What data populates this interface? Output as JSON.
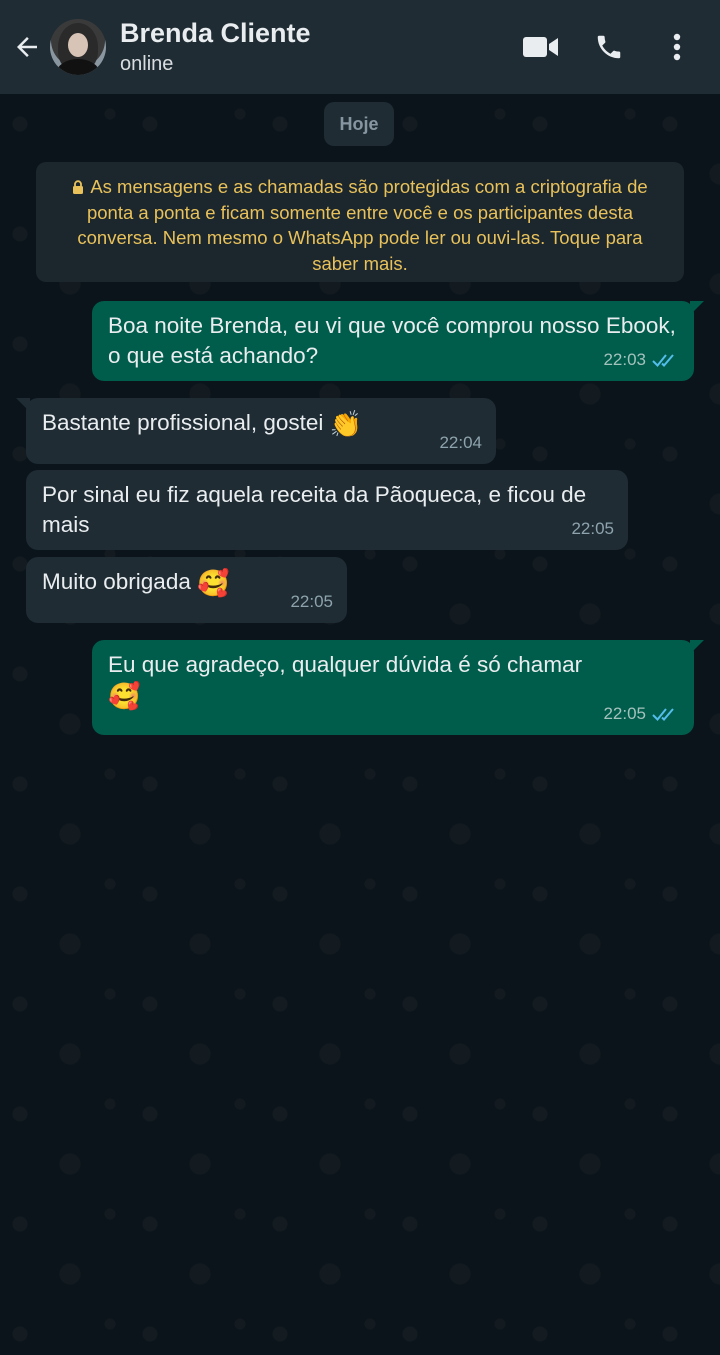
{
  "header": {
    "name": "Brenda Cliente",
    "status": "online",
    "icons": {
      "back": "back-arrow-icon",
      "video": "video-call-icon",
      "call": "phone-call-icon",
      "menu": "more-vert-icon"
    }
  },
  "chat": {
    "date_chip": "Hoje",
    "encryption_notice": "As mensagens e as chamadas são protegidas com a criptografia de ponta a ponta e ficam somente entre você e os participantes desta conversa. Nem mesmo o WhatsApp pode ler ou ouvi-las. Toque para saber mais.",
    "messages": [
      {
        "direction": "out",
        "text": "Boa noite Brenda, eu vi que você comprou nosso Ebook, o que está achando?",
        "time": "22:03",
        "status": "read"
      },
      {
        "direction": "in",
        "text": "Bastante profissional, gostei",
        "emoji": "👏",
        "time": "22:04"
      },
      {
        "direction": "in",
        "text": "Por sinal eu fiz aquela receita da Pãoqueca, e ficou de mais",
        "time": "22:05"
      },
      {
        "direction": "in",
        "text": "Muito obrigada",
        "emoji": "🥰",
        "time": "22:05"
      },
      {
        "direction": "out",
        "text": "Eu que agradeço, qualquer dúvida é só chamar",
        "emoji": "🥰",
        "time": "22:05",
        "status": "read"
      }
    ]
  },
  "colors": {
    "header_bg": "#1f2c34",
    "chat_bg": "#0b141a",
    "outgoing_bubble": "#005c4b",
    "incoming_bubble": "#1f2c34",
    "notice_text": "#e8c15a",
    "read_ticks": "#53bdeb"
  }
}
